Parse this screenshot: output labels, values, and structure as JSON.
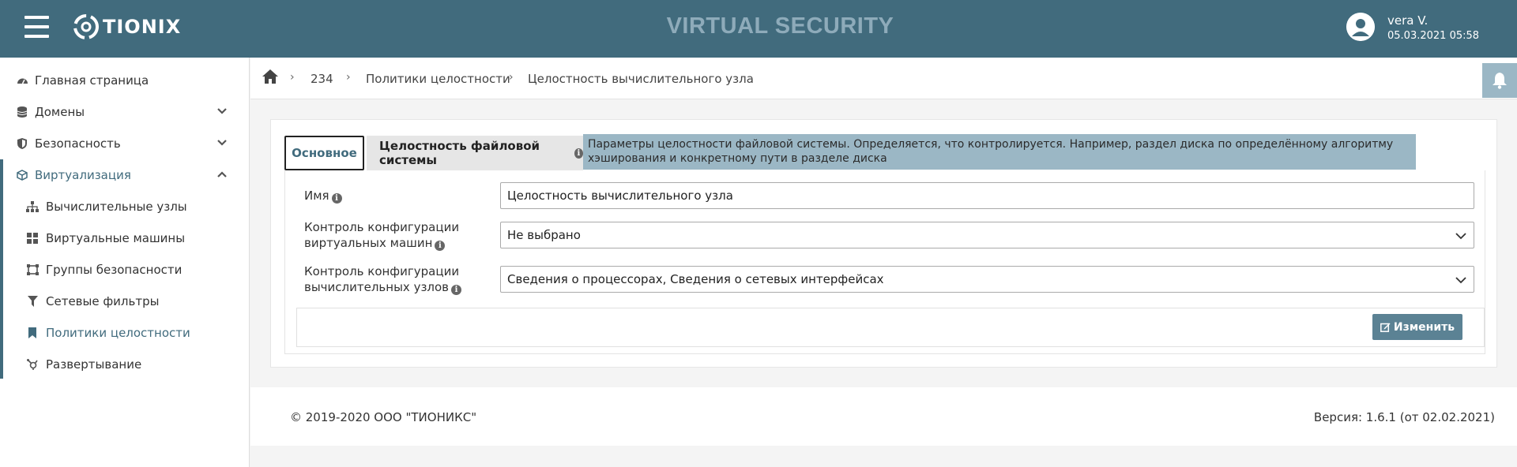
{
  "header": {
    "brand": "TIONIX",
    "app_title": "VIRTUAL SECURITY",
    "user_name": "vera V.",
    "user_date": "05.03.2021 05:58",
    "accent_color": "#416b7d"
  },
  "sidebar": {
    "items": [
      {
        "label": "Главная страница",
        "icon": "dashboard-icon"
      },
      {
        "label": "Домены",
        "icon": "database-icon",
        "expandable": true
      },
      {
        "label": "Безопасность",
        "icon": "shield-icon",
        "expandable": true
      },
      {
        "label": "Виртуализация",
        "icon": "cube-icon",
        "expandable": true,
        "expanded": true
      },
      {
        "label": "Вычислительные узлы",
        "icon": "sitemap-icon"
      },
      {
        "label": "Виртуальные машины",
        "icon": "grid-icon"
      },
      {
        "label": "Группы безопасности",
        "icon": "group-icon"
      },
      {
        "label": "Сетевые фильтры",
        "icon": "filter-icon"
      },
      {
        "label": "Политики целостности",
        "icon": "bookmark-icon",
        "active": true
      },
      {
        "label": "Развертывание",
        "icon": "deploy-icon"
      }
    ]
  },
  "breadcrumb": {
    "items": [
      "234",
      "Политики целостности",
      "Целостность вычислительного узла"
    ]
  },
  "tabs": {
    "main": "Основное",
    "fs": "Целостность файловой системы"
  },
  "tooltip": {
    "text": "Параметры целостности файловой системы. Определяется, что контролируется. Например, раздел диска по определённому алгоритму хэширования и конкретному пути в разделе диска"
  },
  "form": {
    "name_label": "Имя",
    "name_value": "Целостность вычислительного узла",
    "vm_label_1": "Контроль конфигурации",
    "vm_label_2": "виртуальных машин",
    "vm_value": "Не выбрано",
    "node_label_1": "Контроль конфигурации",
    "node_label_2": "вычислительных узлов",
    "node_value": "Сведения о процессорах, Сведения о сетевых интерфейсах",
    "edit_label": "Изменить"
  },
  "footer": {
    "copyright": "© 2019-2020 ООО \"ТИОНИКС\"",
    "version": "Версия: 1.6.1 (от 02.02.2021)"
  }
}
